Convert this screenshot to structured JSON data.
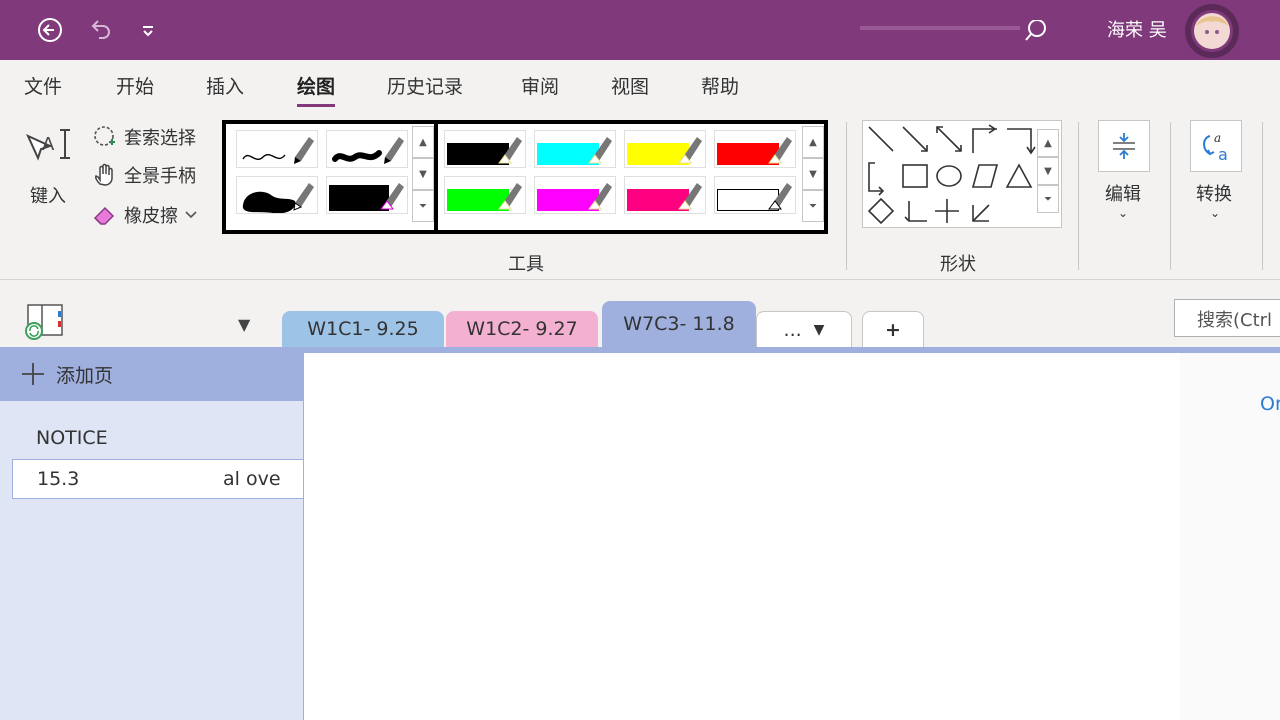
{
  "titlebar": {
    "user_name": "海荣 吴",
    "icons": [
      "back-icon",
      "undo-icon",
      "quick-access-icon",
      "search-icon",
      "avatar"
    ]
  },
  "menu": {
    "tabs": [
      {
        "label": "文件",
        "active": false
      },
      {
        "label": "开始",
        "active": false
      },
      {
        "label": "插入",
        "active": false
      },
      {
        "label": "绘图",
        "active": true
      },
      {
        "label": "历史记录",
        "active": false
      },
      {
        "label": "审阅",
        "active": false
      },
      {
        "label": "视图",
        "active": false
      },
      {
        "label": "帮助",
        "active": false
      }
    ]
  },
  "ribbon": {
    "type_label": "键入",
    "lasso_label": "套索选择",
    "pan_label": "全景手柄",
    "eraser_label": "橡皮擦",
    "tools_group": "工具",
    "shapes_group": "形状",
    "edit_label": "编辑",
    "convert_label": "转换",
    "pens": [
      {
        "ink": "#000000",
        "kind": "thin"
      },
      {
        "ink": "#000000",
        "kind": "thick"
      },
      {
        "ink": "#000000",
        "kind": "blob"
      },
      {
        "ink": "#000000",
        "kind": "marker"
      }
    ],
    "highlighters": [
      {
        "color": "#000000"
      },
      {
        "color": "#00ffff"
      },
      {
        "color": "#ffff00"
      },
      {
        "color": "#ff0000"
      },
      {
        "color": "#00ff00"
      },
      {
        "color": "#ff00ff"
      },
      {
        "color": "#ff0080"
      },
      {
        "color": "#ffffff"
      }
    ]
  },
  "notebook": {
    "sections": [
      {
        "label": "W1C1- 9.25",
        "color": "#9dc3e6"
      },
      {
        "label": "W1C2- 9.27",
        "color": "#f4b0d0"
      },
      {
        "label": "W7C3- 11.8",
        "color": "#9fb0de"
      }
    ],
    "more_label": "...",
    "add_label": "+",
    "search_placeholder": "搜索(Ctrl"
  },
  "pages": {
    "add_page_label": "添加页",
    "group_label": "NOTICE",
    "page_title": "15.3",
    "page_title_fragment": "al ove"
  },
  "canvas": {
    "right_fragment": "Or"
  }
}
